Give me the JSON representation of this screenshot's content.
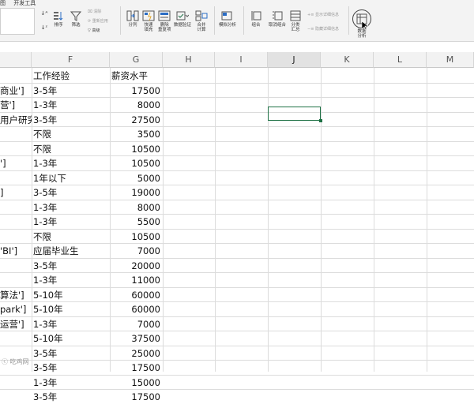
{
  "ribbon": {
    "tabs": [
      "图",
      "开发工具"
    ],
    "sort_label": "排序",
    "filter_label": "筛选",
    "clear_label": "清除",
    "reapply_label": "重新应用",
    "advanced_label": "高级",
    "split_label": "分列",
    "flash_fill_label": "快速\n填充",
    "remove_dup_label": "删除\n重复项",
    "validation_label": "数据验证",
    "consolidate_label": "合并\n计算",
    "whatif_label": "模拟分析",
    "group_label": "组合",
    "ungroup_label": "取消组合",
    "subtotal_label": "分类\n汇总",
    "show_detail_label": "显示详细信息",
    "hide_detail_label": "隐藏详细信息",
    "data_analysis_label": "数据\n分析"
  },
  "columns": [
    "F",
    "G",
    "H",
    "I",
    "J",
    "K",
    "L",
    "M"
  ],
  "selected_column": "J",
  "rows": [
    {
      "e": "",
      "f": "工作经验",
      "g": "薪资水平"
    },
    {
      "e": "商业']",
      "f": "3-5年",
      "g": "17500"
    },
    {
      "e": "营']",
      "f": "1-3年",
      "g": "8000"
    },
    {
      "e": "用户研究",
      "f": "3-5年",
      "g": "27500"
    },
    {
      "e": "",
      "f": "不限",
      "g": "3500"
    },
    {
      "e": "",
      "f": "不限",
      "g": "10500"
    },
    {
      "e": "']",
      "f": "1-3年",
      "g": "10500"
    },
    {
      "e": "",
      "f": "1年以下",
      "g": "5000"
    },
    {
      "e": "]",
      "f": "3-5年",
      "g": "19000"
    },
    {
      "e": "",
      "f": "1-3年",
      "g": "8000"
    },
    {
      "e": "",
      "f": "1-3年",
      "g": "5500"
    },
    {
      "e": "",
      "f": "不限",
      "g": "10500"
    },
    {
      "e": "'BI']",
      "f": "应届毕业生",
      "g": "7000"
    },
    {
      "e": "",
      "f": "3-5年",
      "g": "20000"
    },
    {
      "e": "",
      "f": "1-3年",
      "g": "11000"
    },
    {
      "e": "算法']",
      "f": "5-10年",
      "g": "60000"
    },
    {
      "e": "park']",
      "f": "5-10年",
      "g": "60000"
    },
    {
      "e": "运营']",
      "f": "1-3年",
      "g": "7000"
    },
    {
      "e": "",
      "f": "5-10年",
      "g": "37500"
    },
    {
      "e": "",
      "f": "3-5年",
      "g": "25000"
    },
    {
      "e": "",
      "f": "3-5年",
      "g": "17500"
    },
    {
      "e": "",
      "f": "1-3年",
      "g": "15000"
    },
    {
      "e": "",
      "f": "3-5年",
      "g": "17500"
    }
  ],
  "watermark": "吃鸡网"
}
